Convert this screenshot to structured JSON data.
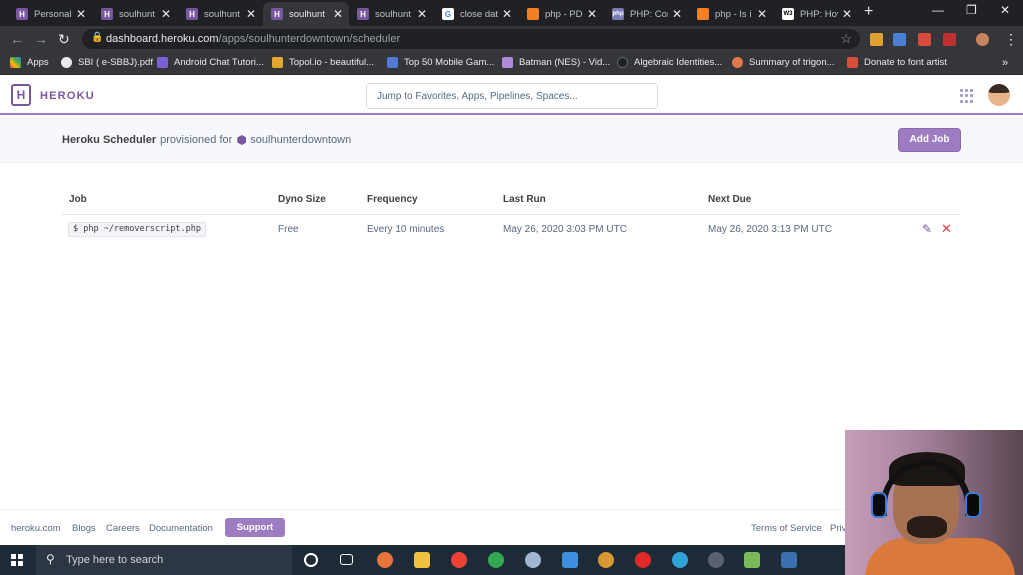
{
  "browser": {
    "tabs": [
      {
        "title": "Personal",
        "active": false
      },
      {
        "title": "soulhunt",
        "active": false
      },
      {
        "title": "soulhunt",
        "active": false
      },
      {
        "title": "soulhunt",
        "active": true
      },
      {
        "title": "soulhunt",
        "active": false
      },
      {
        "title": "close dat",
        "active": false
      },
      {
        "title": "php - PD",
        "active": false
      },
      {
        "title": "PHP: Cor",
        "active": false
      },
      {
        "title": "php - Is i",
        "active": false
      },
      {
        "title": "PHP: Hov",
        "active": false
      }
    ],
    "url_host": "dashboard.heroku.com",
    "url_path": "/apps/soulhunterdowntown/scheduler",
    "bookmarks": [
      "Apps",
      "SBI ( e-SBBJ).pdf",
      "Android Chat Tutori...",
      "Topol.io - beautiful...",
      "Top 50 Mobile Gam...",
      "Batman (NES) - Vid...",
      "Algebraic Identities...",
      "Summary of trigon...",
      "Donate to font artist"
    ]
  },
  "header": {
    "brand": "HEROKU",
    "search_placeholder": "Jump to Favorites, Apps, Pipelines, Spaces..."
  },
  "scheduler": {
    "title": "Heroku Scheduler",
    "provisioned_for": "provisioned for",
    "app_name": "soulhunterdowntown",
    "add_job_label": "Add Job"
  },
  "jobs_table": {
    "headers": [
      "Job",
      "Dyno Size",
      "Frequency",
      "Last Run",
      "Next Due"
    ],
    "rows": [
      {
        "command": "$ php ~/removerscript.php",
        "dyno_size": "Free",
        "frequency": "Every 10 minutes",
        "last_run": "May 26, 2020 3:03 PM UTC",
        "next_due": "May 26, 2020 3:13 PM UTC"
      }
    ]
  },
  "footer": {
    "links": [
      "heroku.com",
      "Blogs",
      "Careers",
      "Documentation"
    ],
    "support_label": "Support",
    "right_links": [
      "Terms of Service",
      "Priv"
    ]
  },
  "taskbar": {
    "search_placeholder": "Type here to search"
  },
  "colors": {
    "heroku_purple": "#79589f",
    "button_purple": "#9e7cc1",
    "delete_red": "#d64242"
  }
}
